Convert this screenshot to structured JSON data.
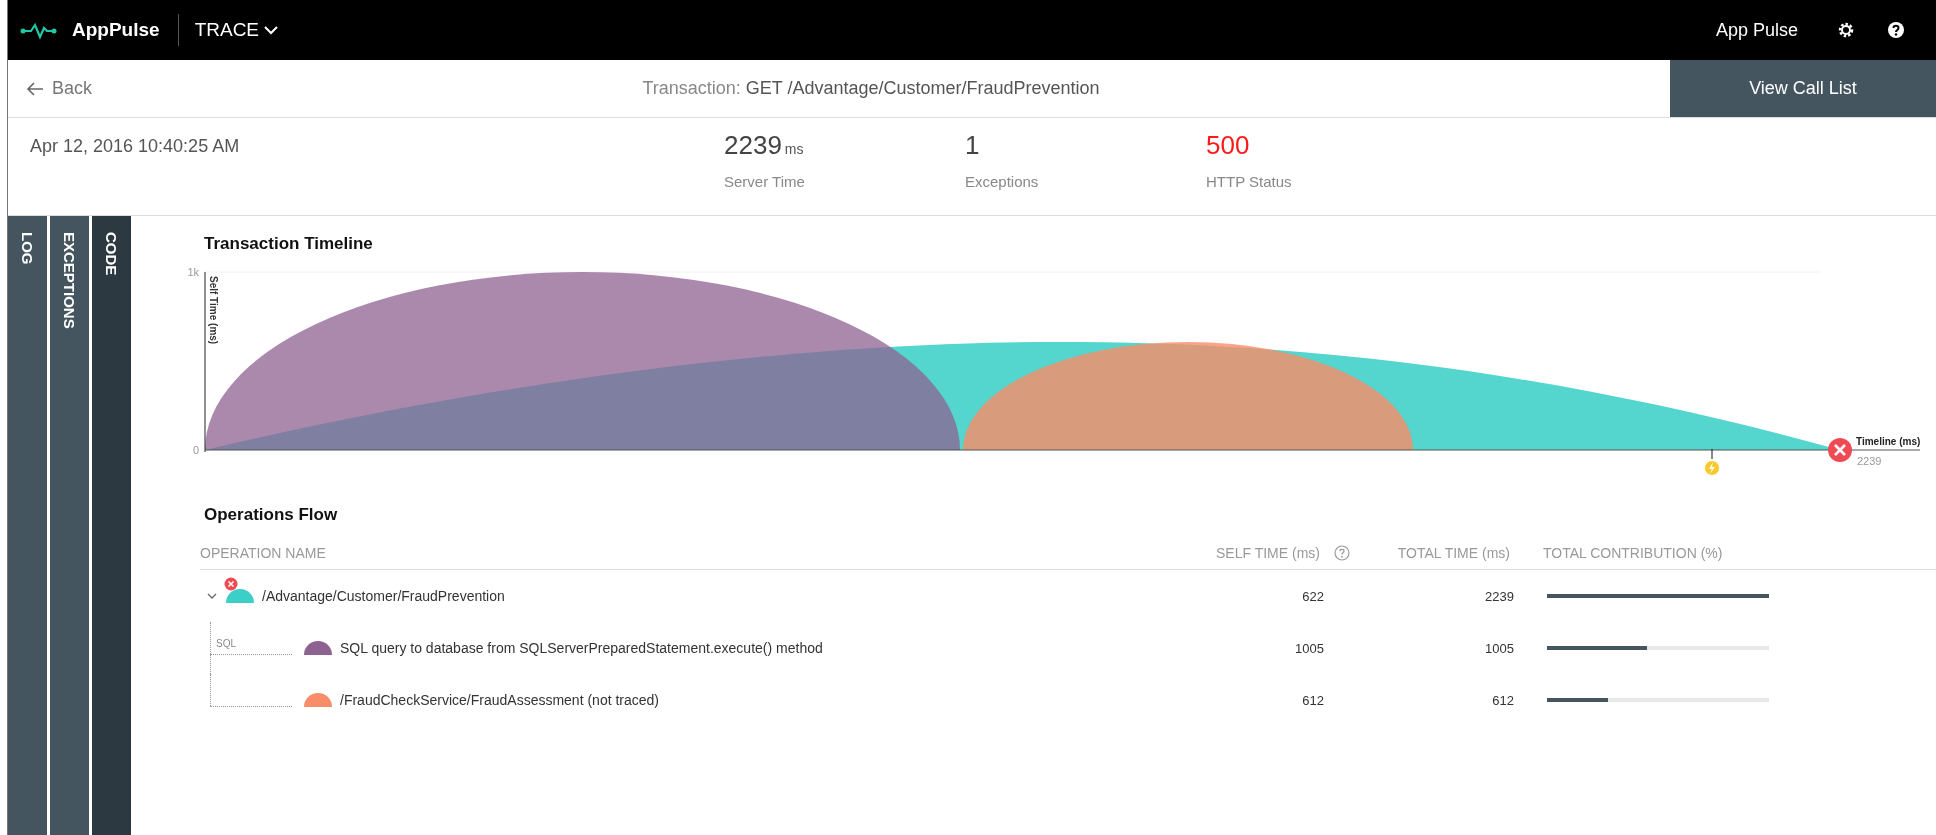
{
  "top_bar": {
    "product": "AppPulse",
    "module_menu": "TRACE",
    "user_label": "App Pulse"
  },
  "nav_bar": {
    "back": "Back",
    "title_label": "Transaction:",
    "title_value": "GET /Advantage/Customer/FraudPrevention",
    "action": "View Call List"
  },
  "summary": {
    "timestamp": "Apr 12, 2016 10:40:25 AM",
    "stats": [
      {
        "value": "2239",
        "unit": "ms",
        "label": "Server Time",
        "error": false
      },
      {
        "value": "1",
        "label": "Exceptions",
        "error": false
      },
      {
        "value": "500",
        "label": "HTTP Status",
        "error": true
      }
    ]
  },
  "side_tabs": [
    {
      "label": "LOG",
      "selected": false
    },
    {
      "label": "EXCEPTIONS",
      "selected": false
    },
    {
      "label": "CODE",
      "selected": true
    }
  ],
  "timeline": {
    "title": "Transaction Timeline",
    "y_axis_label": "Self Time (ms)",
    "y_ticks": [
      "1k",
      "0"
    ],
    "x_axis_label": "Timeline (ms)",
    "x_end_label": "2239"
  },
  "operations_flow": {
    "title": "Operations Flow",
    "columns": [
      "OPERATION NAME",
      "SELF TIME (ms)",
      "TOTAL TIME (ms)",
      "TOTAL CONTRIBUTION (%)"
    ],
    "rows": [
      {
        "name": "/Advantage/Customer/FraudPrevention",
        "self_time": "622",
        "total_time": "2239",
        "level": 1.0,
        "color": "#3ccfc7",
        "error": true,
        "expanded": true,
        "children": [
          {
            "name": "SQL query to database from SQLServerPreparedStatement.execute() method",
            "connector_label": "SQL",
            "self_time": "1005",
            "total_time": "1005",
            "level": 0.449,
            "color": "#8d6291",
            "error": false
          },
          {
            "name": "/FraudCheckService/FraudAssessment (not traced)",
            "self_time": "612",
            "total_time": "612",
            "level": 0.273,
            "color": "#f98d69",
            "error": false
          }
        ]
      }
    ]
  }
}
